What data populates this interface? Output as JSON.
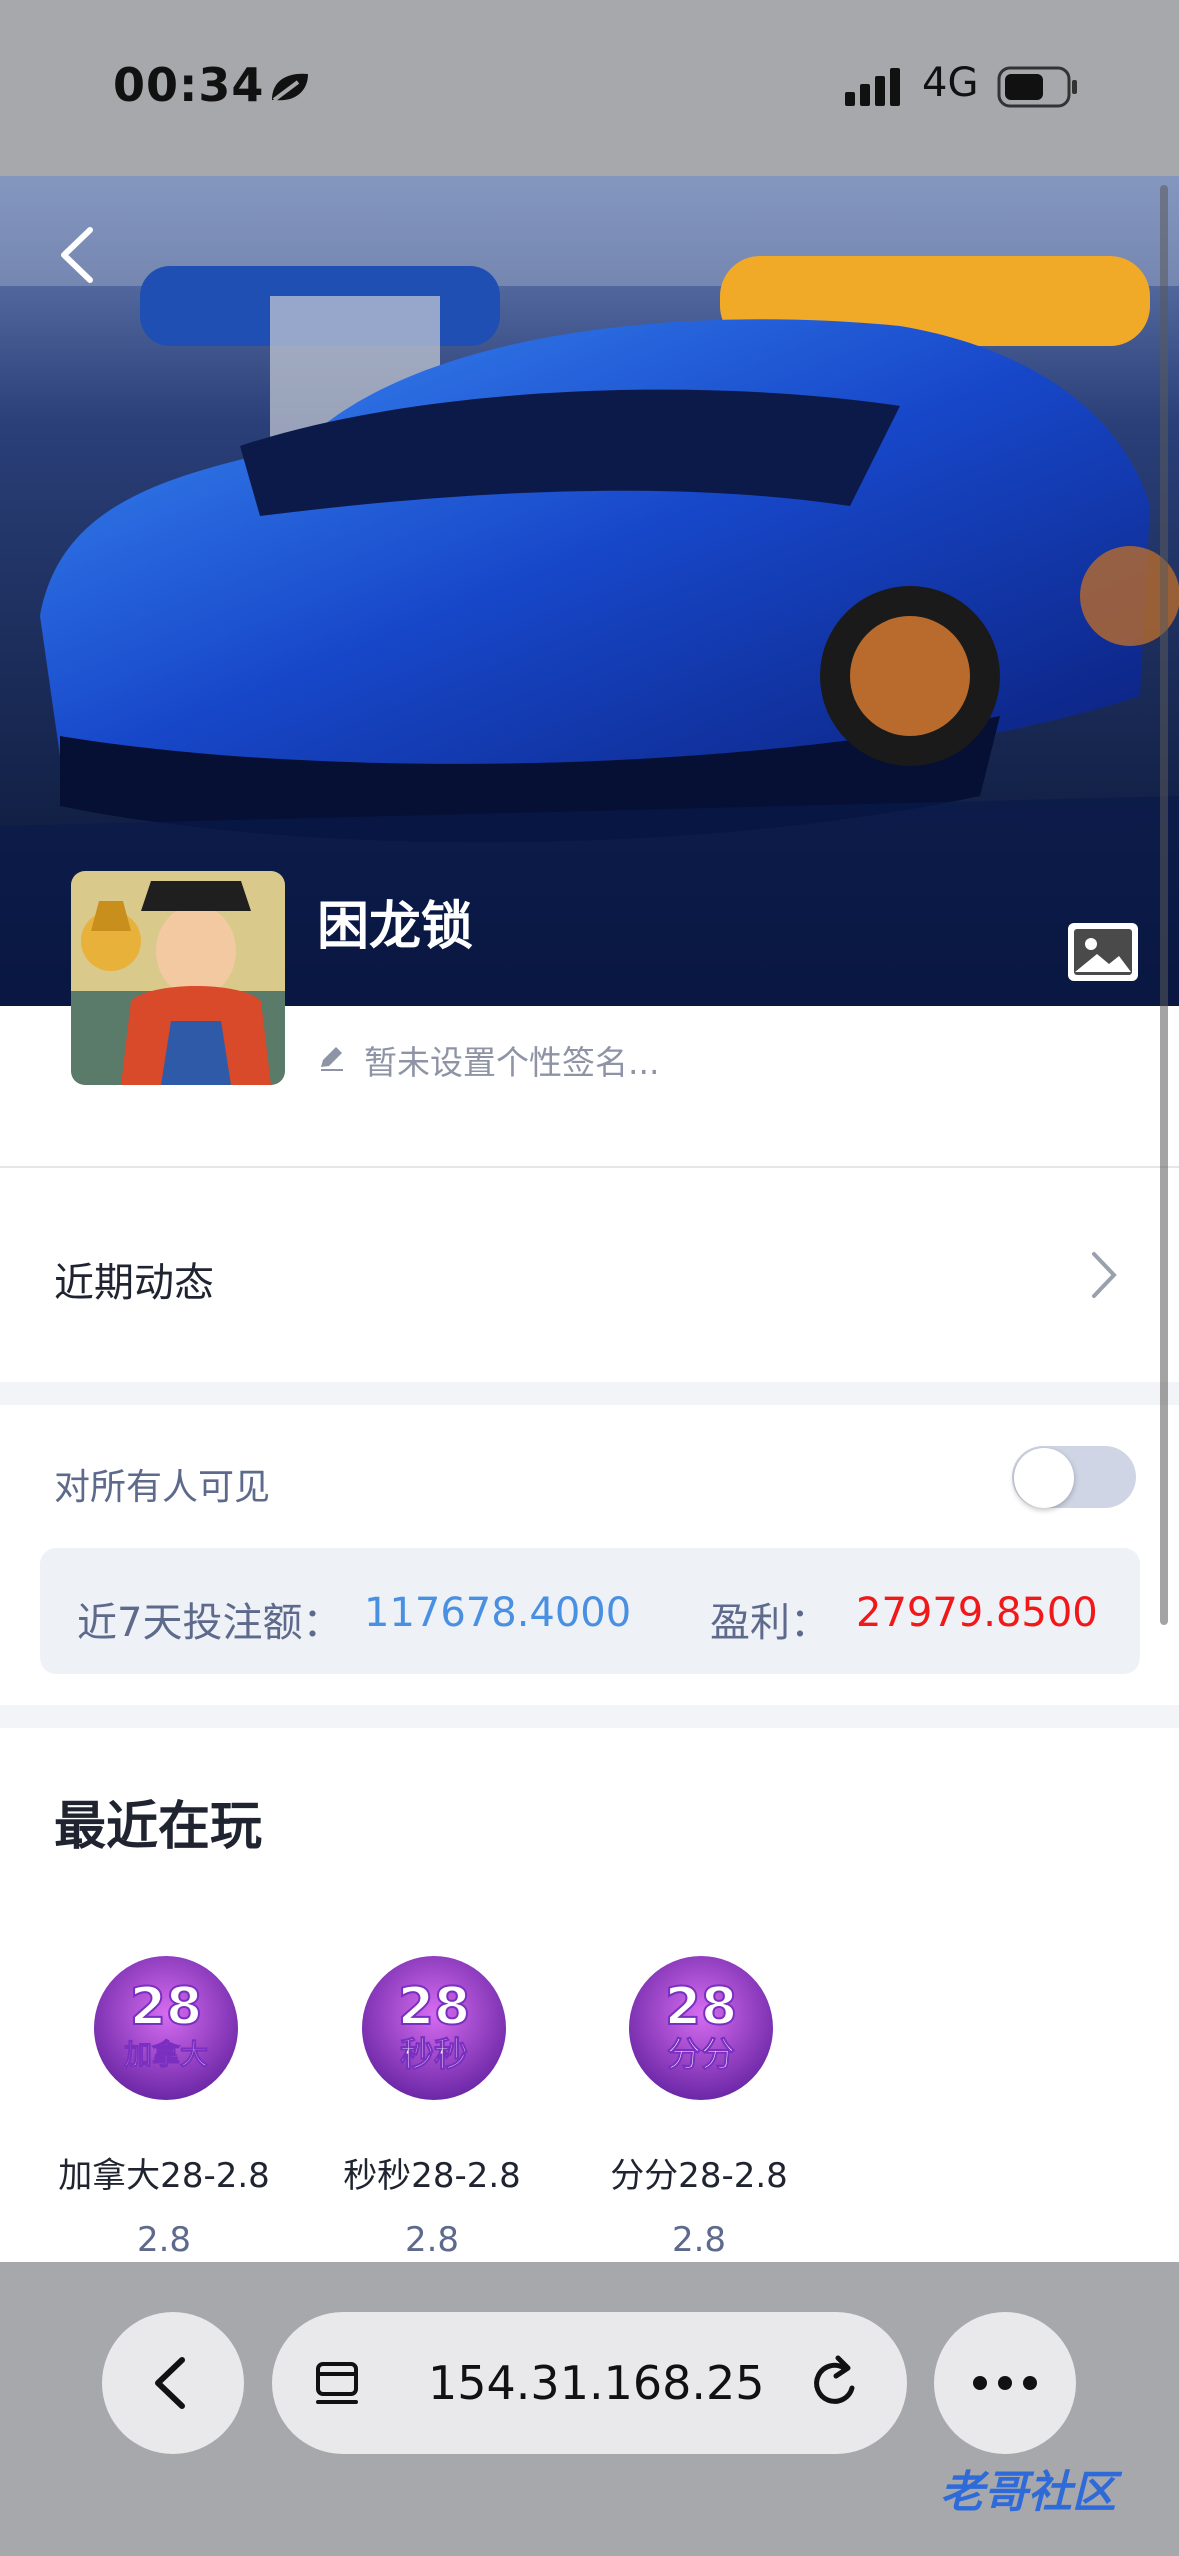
{
  "status_bar": {
    "time": "00:34",
    "network": "4G"
  },
  "profile": {
    "username": "困龙锁",
    "signature_placeholder": "暂未设置个性签名..."
  },
  "recent_activity": {
    "label": "近期动态"
  },
  "visibility": {
    "label": "对所有人可见",
    "enabled": false
  },
  "stats": {
    "bet_label": "近7天投注额：",
    "bet_value": "117678.4000",
    "profit_label": "盈利：",
    "profit_value": "27979.8500"
  },
  "recent_playing": {
    "title": "最近在玩",
    "games": [
      {
        "icon_text_top": "28",
        "icon_text_bottom": "加拿大",
        "name": "加拿大28-2.8",
        "odds": "2.8"
      },
      {
        "icon_text_top": "28",
        "icon_text_bottom": "秒秒",
        "name": "秒秒28-2.8",
        "odds": "2.8"
      },
      {
        "icon_text_top": "28",
        "icon_text_bottom": "分分",
        "name": "分分28-2.8",
        "odds": "2.8"
      }
    ]
  },
  "browser": {
    "url": "154.31.168.25"
  },
  "watermark": "老哥社区",
  "colors": {
    "accent_blue": "#4a90e2",
    "profit_red": "#f01818",
    "muted_text": "#5d6a8c"
  },
  "icons": [
    "leaf-icon",
    "signal-icon",
    "battery-icon",
    "back-icon",
    "image-icon",
    "pencil-icon",
    "chevron-right-icon",
    "tabs-icon",
    "reload-icon",
    "more-icon"
  ]
}
